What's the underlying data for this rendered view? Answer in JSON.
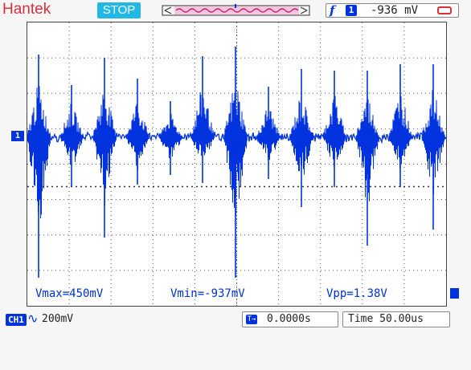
{
  "header": {
    "brand": "Hantek",
    "run_state": "STOP",
    "trigger": {
      "edge_icon": "f",
      "channel": "1",
      "level": "-936 mV"
    }
  },
  "readouts": {
    "vmax": "Vmax=450mV",
    "vmin": "Vmin=-937mV",
    "vpp": "Vpp=1.38V"
  },
  "footer": {
    "channel": "CH1",
    "coupling": "∿",
    "volts_per_div": "200mV",
    "trigger_position": "0.0000s",
    "timebase": "Time 50.00us"
  },
  "markers": {
    "channel_marker": "1",
    "trigger_pos_marker": "T"
  },
  "colors": {
    "trace": "#0033dd",
    "brand": "#d9303a",
    "stop_bg": "#22b8e6",
    "grid": "#555555"
  }
}
